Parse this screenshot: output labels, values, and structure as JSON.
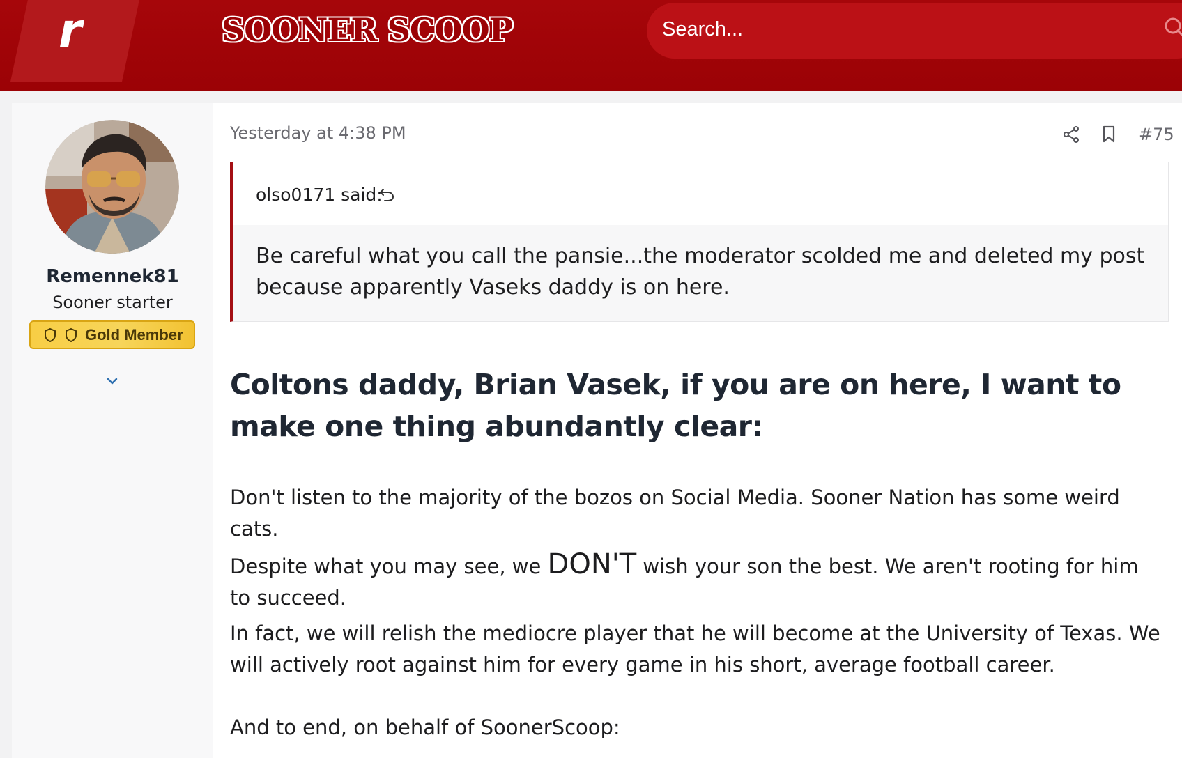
{
  "header": {
    "logo_letter": "r",
    "brand": "SOONER SCOOP",
    "search_placeholder": "Search..."
  },
  "author": {
    "username": "Remennek81",
    "user_title": "Sooner starter",
    "badge": "Gold Member"
  },
  "post": {
    "date": "Yesterday at 4:38 PM",
    "number": "#75",
    "quote": {
      "author": "olso0171 said:",
      "text": "Be careful what you call the pansie...the moderator scolded me and deleted my post because apparently Vaseks daddy is on here."
    },
    "heading": "Coltons daddy, Brian Vasek, if you are on here, I want to make one thing abundantly clear:",
    "paragraph_1": "Don't listen to the majority of the bozos on Social Media. Sooner Nation has some weird cats.",
    "paragraph_2_before": "Despite what you may see, we ",
    "paragraph_2_emphasis": "DON'T",
    "paragraph_2_after": " wish your son the best. We aren't rooting for him to succeed.",
    "paragraph_3": "In fact, we will relish the mediocre player that he will become at the University of Texas. We will actively root against him for every game in his short, average football career.",
    "paragraph_4": "And to end, on behalf of SoonerScoop:"
  },
  "colors": {
    "header_red": "#9b0205",
    "quote_bar": "#a40f14",
    "badge_gold": "#f8ce45"
  },
  "icons": [
    "search-icon",
    "shield-icon",
    "chevron-down-icon",
    "share-icon",
    "bookmark-icon",
    "reply-icon"
  ]
}
